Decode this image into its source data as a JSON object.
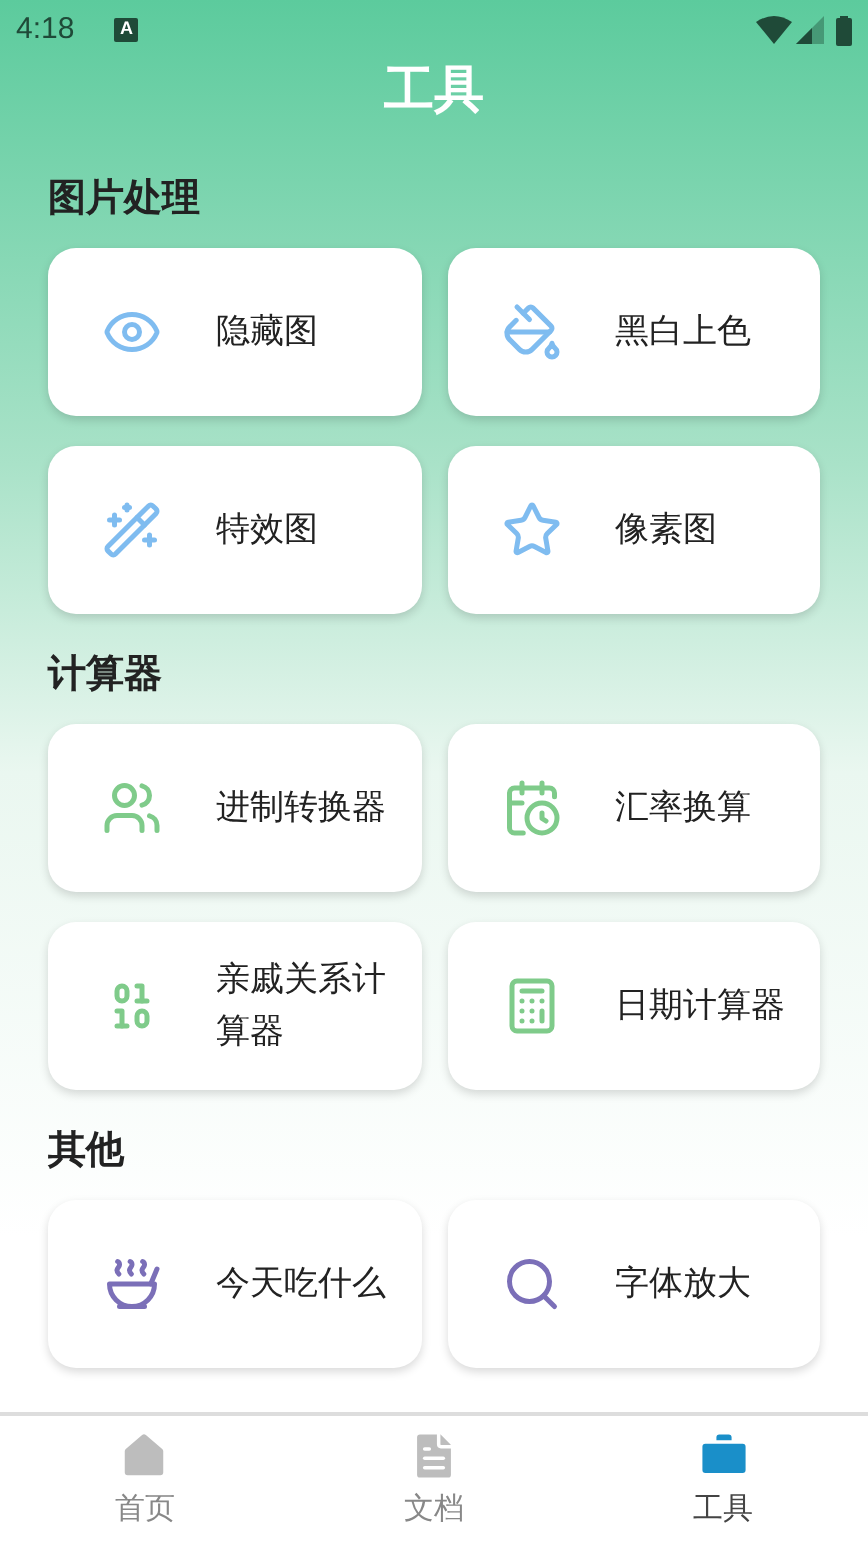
{
  "status_bar": {
    "time": "4:18",
    "notification": "A"
  },
  "title": "工具",
  "sections": [
    {
      "title": "图片处理",
      "tools": [
        {
          "label": "隐藏图"
        },
        {
          "label": "黑白上色"
        },
        {
          "label": "特效图"
        },
        {
          "label": "像素图"
        }
      ]
    },
    {
      "title": "计算器",
      "tools": [
        {
          "label": "进制转换器"
        },
        {
          "label": "汇率换算"
        },
        {
          "label": "亲戚关系计算器"
        },
        {
          "label": "日期计算器"
        }
      ]
    },
    {
      "title": "其他",
      "tools": [
        {
          "label": "今天吃什么"
        },
        {
          "label": "字体放大"
        }
      ]
    }
  ],
  "tabs": [
    {
      "label": "首页",
      "selected": false
    },
    {
      "label": "文档",
      "selected": false
    },
    {
      "label": "工具",
      "selected": true
    }
  ]
}
